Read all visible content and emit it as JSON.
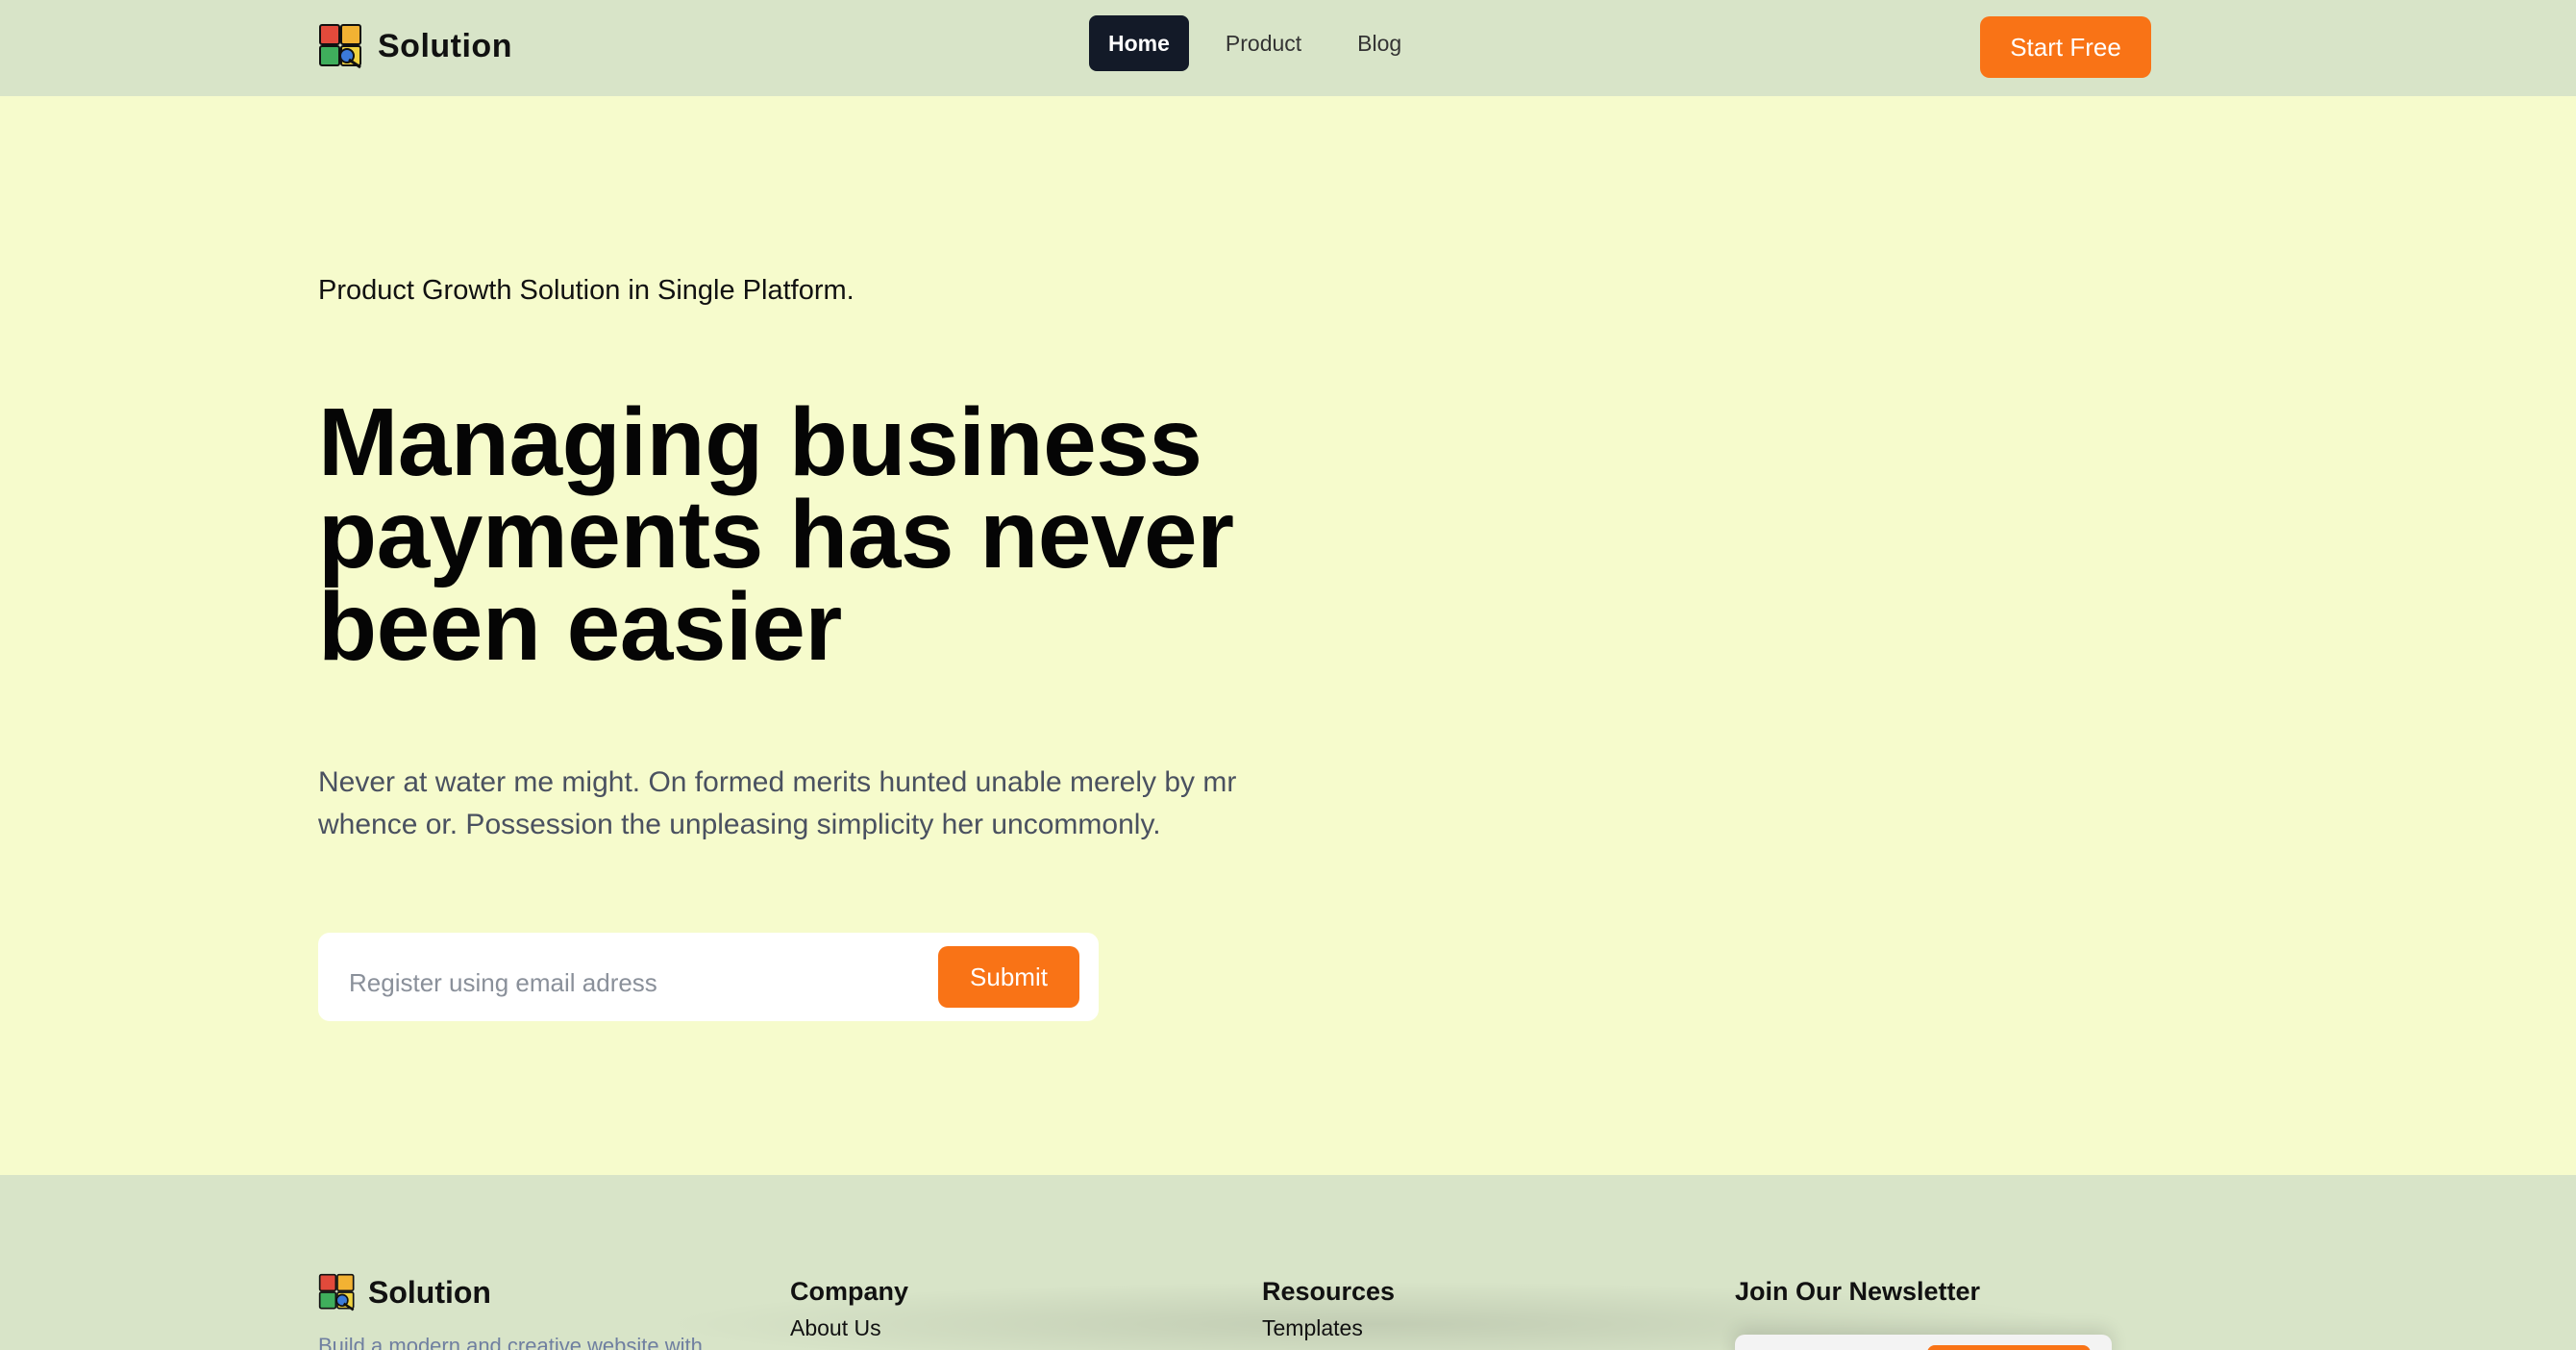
{
  "header": {
    "brand": "Solution",
    "nav": [
      "Home",
      "Product",
      "Blog"
    ],
    "active_nav": "Home",
    "cta": "Start Free"
  },
  "hero": {
    "eyebrow": "Product Growth Solution in Single Platform.",
    "headline": "Managing business payments has never been easier",
    "description": "Never at water me might. On formed merits hunted unable merely by mr whence or. Possession the unpleasing simplicity her uncommonly.",
    "email_placeholder": "Register using email adress",
    "submit": "Submit"
  },
  "footer": {
    "brand": "Solution",
    "tagline": "Build a modern and creative website with",
    "columns": [
      {
        "title": "Company",
        "links": [
          "About Us"
        ]
      },
      {
        "title": "Resources",
        "links": [
          "Templates"
        ]
      }
    ],
    "newsletter_title": "Join Our Newsletter"
  },
  "colors": {
    "accent": "#f97316",
    "header_bg": "#d8e4c8",
    "hero_bg": "#f6fbcc",
    "active_nav_bg": "#131a28"
  }
}
